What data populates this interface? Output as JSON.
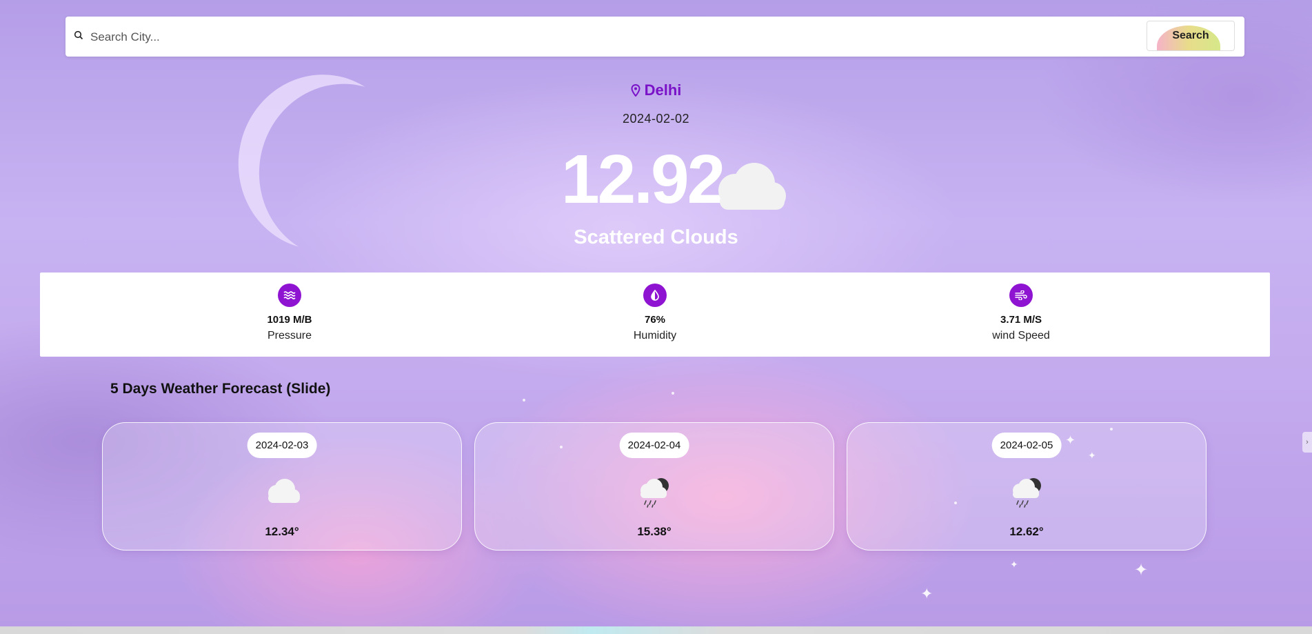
{
  "search": {
    "placeholder": "Search City...",
    "value": "",
    "button_label": "Search"
  },
  "current": {
    "city": "Delhi",
    "date": "2024-02-02",
    "temperature": "12.92",
    "description": "Scattered Clouds",
    "icon": "cloud-icon"
  },
  "stats": [
    {
      "value": "1019 M/B",
      "label": "Pressure",
      "icon": "pressure-waves-icon"
    },
    {
      "value": "76%",
      "label": "Humidity",
      "icon": "humidity-drop-icon"
    },
    {
      "value": "3.71 M/S",
      "label": "wind Speed",
      "icon": "wind-icon"
    }
  ],
  "forecast": {
    "title": "5 Days Weather Forecast (Slide)",
    "days": [
      {
        "date": "2024-02-03",
        "temp": "12.34°",
        "icon": "cloud-icon"
      },
      {
        "date": "2024-02-04",
        "temp": "15.38°",
        "icon": "night-rain-icon"
      },
      {
        "date": "2024-02-05",
        "temp": "12.62°",
        "icon": "night-rain-icon"
      }
    ]
  },
  "colors": {
    "accent": "#8e14d2",
    "location": "#7a12c7",
    "background": "#c7b3f2"
  }
}
